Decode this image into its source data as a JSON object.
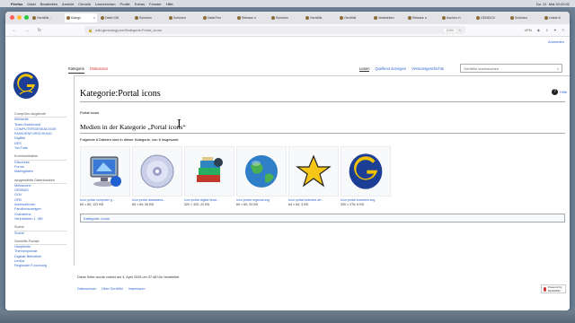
{
  "menubar": {
    "app": "Firefox",
    "items": [
      "Datei",
      "Bearbeiten",
      "Ansicht",
      "Chronik",
      "Lesezeichen",
      "Profile",
      "Extras",
      "Fenster",
      "Hilfe"
    ],
    "clock": "Do. 21. Mai 20:20:52"
  },
  "tabs": [
    {
      "label": "GenWiki ..."
    },
    {
      "label": "Katego"
    },
    {
      "label": "Datei:GW"
    },
    {
      "label": "Schönen"
    },
    {
      "label": "Schönen"
    },
    {
      "label": "Datei:Fen"
    },
    {
      "label": "Release n"
    },
    {
      "label": "Schönen"
    },
    {
      "label": "GenWiki"
    },
    {
      "label": "GenWiki"
    },
    {
      "label": "Verdeleken"
    },
    {
      "label": "Release n"
    },
    {
      "label": "Aachen-H"
    },
    {
      "label": "GENIDOV"
    },
    {
      "label": "Schönen"
    },
    {
      "label": "Letzte Ä"
    }
  ],
  "url": "wiki.genealogy.net/Kategorie:Portal_icons",
  "zoom": "110%",
  "vpn": "VPN",
  "login": "Anmelden",
  "sidebar": {
    "group1_heading": "CompGen-Angebote",
    "group1": [
      "Webseite",
      "Team-Dashboard",
      "COMPUTERGENEALOGIE",
      "FAMILIENFORSCHUNG",
      "DigiBib",
      "DES",
      "YouTube"
    ],
    "group2_heading": "Kommunikation",
    "group2": [
      "Discourse",
      "Forum",
      "Mailinglisten"
    ],
    "group3_heading": "ausgewählte Datenbanken",
    "group3": [
      "Metasuche",
      "GEDBAS",
      "GOV",
      "OFB",
      "Adressbücher",
      "Familienanzeigen",
      "Grabsteine",
      "Verlustlisten 1. WK"
    ],
    "group4_heading": "Suche",
    "group4": [
      "Suche"
    ],
    "group5_heading": "GenWiki-Portale",
    "group5": [
      "Hauptseite",
      "Themenportale",
      "Digitale Bibliothek",
      "Lexika",
      "Regionale Forschung"
    ]
  },
  "content_tabs": {
    "kategorie": "Kategorie",
    "diskussion": "Diskussion"
  },
  "view_tabs": {
    "lesen": "Lesen",
    "quelltext": "Quelltext anzeigen",
    "versionen": "Versionsgeschichte"
  },
  "search": {
    "placeholder": "GenWiki durchsuchen"
  },
  "help": "Hilfe",
  "page": {
    "title": "Kategorie:Portal icons",
    "intro": "Portal Icons",
    "section_heading": "Medien in der Kategorie „Portal icons“",
    "count_text": "Folgende 6 Dateien sind in dieser Kategorie, von 6 insgesamt."
  },
  "gallery": [
    {
      "name": "Icon portal computer g...",
      "meta": "60 × 60; 123 KB",
      "icon": "computer-icon"
    },
    {
      "name": "Icon portal databases...",
      "meta": "60 × 60; 26 KB",
      "icon": "cd-icon"
    },
    {
      "name": "Icon portal digital librar...",
      "meta": "320 × 320; 22 KB",
      "icon": "books-icon"
    },
    {
      "name": "Icon portal regional.svg",
      "meta": "60 × 60; 24 KB",
      "icon": "globe-icon"
    },
    {
      "name": "Icon portal selected art...",
      "meta": "64 × 64; 3 KB",
      "icon": "star-icon"
    },
    {
      "name": "Icon portal societies.svg",
      "meta": "330 × 276; 6 KB",
      "icon": "genwiki-g-icon"
    }
  ],
  "categories": {
    "label": "Kategorie",
    "items": [
      "Icons"
    ]
  },
  "footer": {
    "last_edit": "Diese Seite wurde zuletzt am 4. April 2026 um 07:48 Uhr bearbeitet.",
    "links": [
      "Datenschutz",
      "Über GenWiki",
      "Impressum"
    ],
    "powered": "Powered by MediaWiki"
  },
  "colors": {
    "link": "#3366cc",
    "redlink": "#dd3333",
    "logo_blue": "#1c3f95",
    "logo_gold": "#f2c200"
  }
}
